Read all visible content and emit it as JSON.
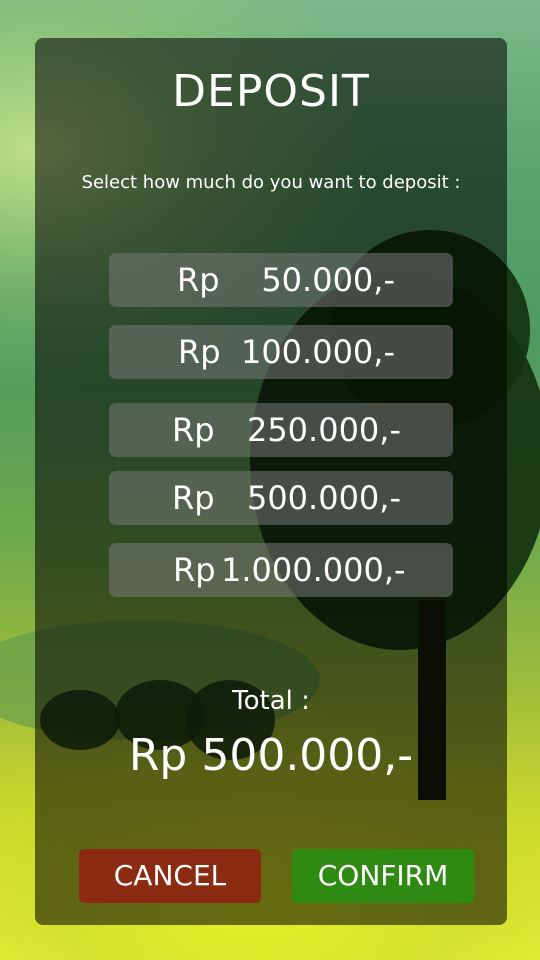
{
  "dialog": {
    "title": "DEPOSIT",
    "subtitle": "Select how much do you want to deposit :"
  },
  "options": [
    {
      "currency": "Rp",
      "amount": "50.000,-"
    },
    {
      "currency": "Rp",
      "amount": "100.000,-"
    },
    {
      "currency": "Rp",
      "amount": "250.000,-"
    },
    {
      "currency": "Rp",
      "amount": "500.000,-"
    },
    {
      "currency": "Rp",
      "amount": "1.000.000,-"
    }
  ],
  "total": {
    "label": "Total :",
    "value": "Rp 500.000,-"
  },
  "buttons": {
    "cancel": "CANCEL",
    "confirm": "CONFIRM"
  },
  "colors": {
    "cancel": "#8a2b12",
    "confirm": "#2e8a12"
  }
}
